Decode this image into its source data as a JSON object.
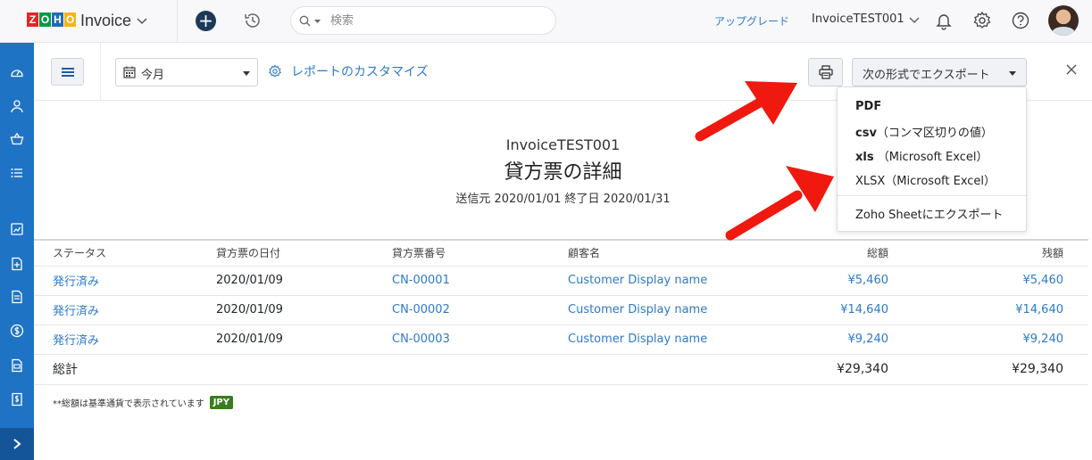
{
  "topbar": {
    "logo_letters": [
      "Z",
      "O",
      "H",
      "O"
    ],
    "logo_colors": [
      "#e42527",
      "#089949",
      "#226db4",
      "#f9b21d"
    ],
    "app_name": "Invoice",
    "search_placeholder": "検索",
    "upgrade_label": "アップグレード",
    "org_name": "InvoiceTEST001"
  },
  "sidebar": {
    "icons": [
      "dashboard-icon",
      "contacts-icon",
      "items-icon",
      "list-icon",
      "reports-icon",
      "invoice-icon",
      "document-icon",
      "payment-icon",
      "receipt-icon",
      "bill-icon"
    ],
    "accent": "#1f73c5"
  },
  "toolbar": {
    "period_label": "今月",
    "customize_label": "レポートのカスタマイズ",
    "export_label": "次の形式でエクスポート"
  },
  "report": {
    "org": "InvoiceTEST001",
    "title": "貸方票の詳細",
    "range": "送信元 2020/01/01 終了日 2020/01/31",
    "columns": [
      "ステータス",
      "貸方票の日付",
      "貸方票番号",
      "顧客名",
      "総額",
      "残額"
    ],
    "rows": [
      {
        "status": "発行済み",
        "date": "2020/01/09",
        "number": "CN-00001",
        "customer": "Customer Display name",
        "total": "¥5,460",
        "balance": "¥5,460"
      },
      {
        "status": "発行済み",
        "date": "2020/01/09",
        "number": "CN-00002",
        "customer": "Customer Display name",
        "total": "¥14,640",
        "balance": "¥14,640"
      },
      {
        "status": "発行済み",
        "date": "2020/01/09",
        "number": "CN-00003",
        "customer": "Customer Display name",
        "total": "¥9,240",
        "balance": "¥9,240"
      }
    ],
    "total_label": "総計",
    "grand_total": "¥29,340",
    "grand_balance": "¥29,340",
    "note": "**総額は基準通貨で表示されています",
    "currency_badge": "JPY"
  },
  "export_menu": {
    "pdf": "PDF",
    "csv_bold": "csv",
    "csv_rest": "（コンマ区切りの値）",
    "xls_bold": "xls",
    "xls_rest": " （Microsoft Excel）",
    "xlsx": "XLSX（Microsoft Excel）",
    "zoho_sheet": "Zoho Sheetにエクスポート"
  }
}
